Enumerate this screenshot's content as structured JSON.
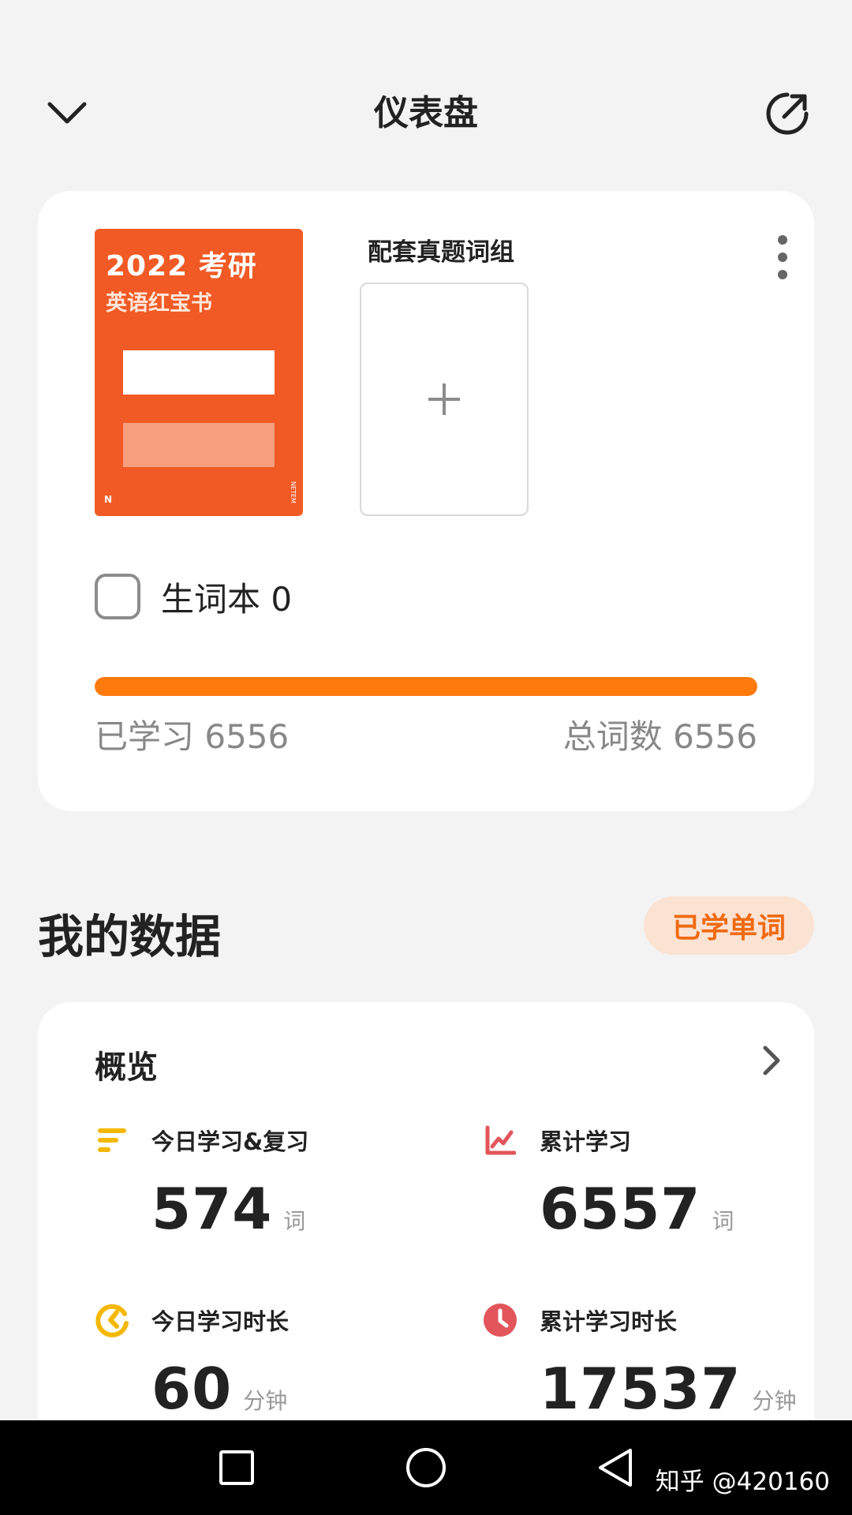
{
  "header": {
    "title": "仪表盘",
    "collapse_icon": "chevron-down-icon",
    "share_icon": "share-arrow-icon"
  },
  "book": {
    "cover_year": "2022 考研",
    "cover_subtitle": "英语红宝书",
    "cover_mark_left": "N",
    "cover_mark_right": "NETEM",
    "related_label": "配套真题词组",
    "add_icon": "plus-icon",
    "more_icon": "more-vertical-icon",
    "vocab_label": "生词本 0",
    "progress_fraction": 1.0,
    "learned_text": "已学习 6556",
    "total_text": "总词数 6556",
    "accent_color": "#ff7a0c",
    "cover_color": "#f15a25"
  },
  "my_data": {
    "title": "我的数据",
    "filter_pill": "已学单词"
  },
  "overview": {
    "title": "概览",
    "arrow_icon": "chevron-right-icon",
    "stats": [
      {
        "label": "今日学习&复习",
        "value": "574",
        "unit": "词",
        "icon": "bars-icon",
        "color": "#f5b800"
      },
      {
        "label": "累计学习",
        "value": "6557",
        "unit": "词",
        "icon": "line-chart-icon",
        "color": "#e2565b"
      },
      {
        "label": "今日学习时长",
        "value": "60",
        "unit": "分钟",
        "icon": "timer-icon",
        "color": "#f5b800"
      },
      {
        "label": "累计学习时长",
        "value": "17537",
        "unit": "分钟",
        "icon": "clock-icon",
        "color": "#e2565b"
      }
    ]
  },
  "navbar": {
    "recent_icon": "square-icon",
    "home_icon": "circle-icon",
    "back_icon": "triangle-back-icon",
    "watermark": "知乎 @420160"
  }
}
